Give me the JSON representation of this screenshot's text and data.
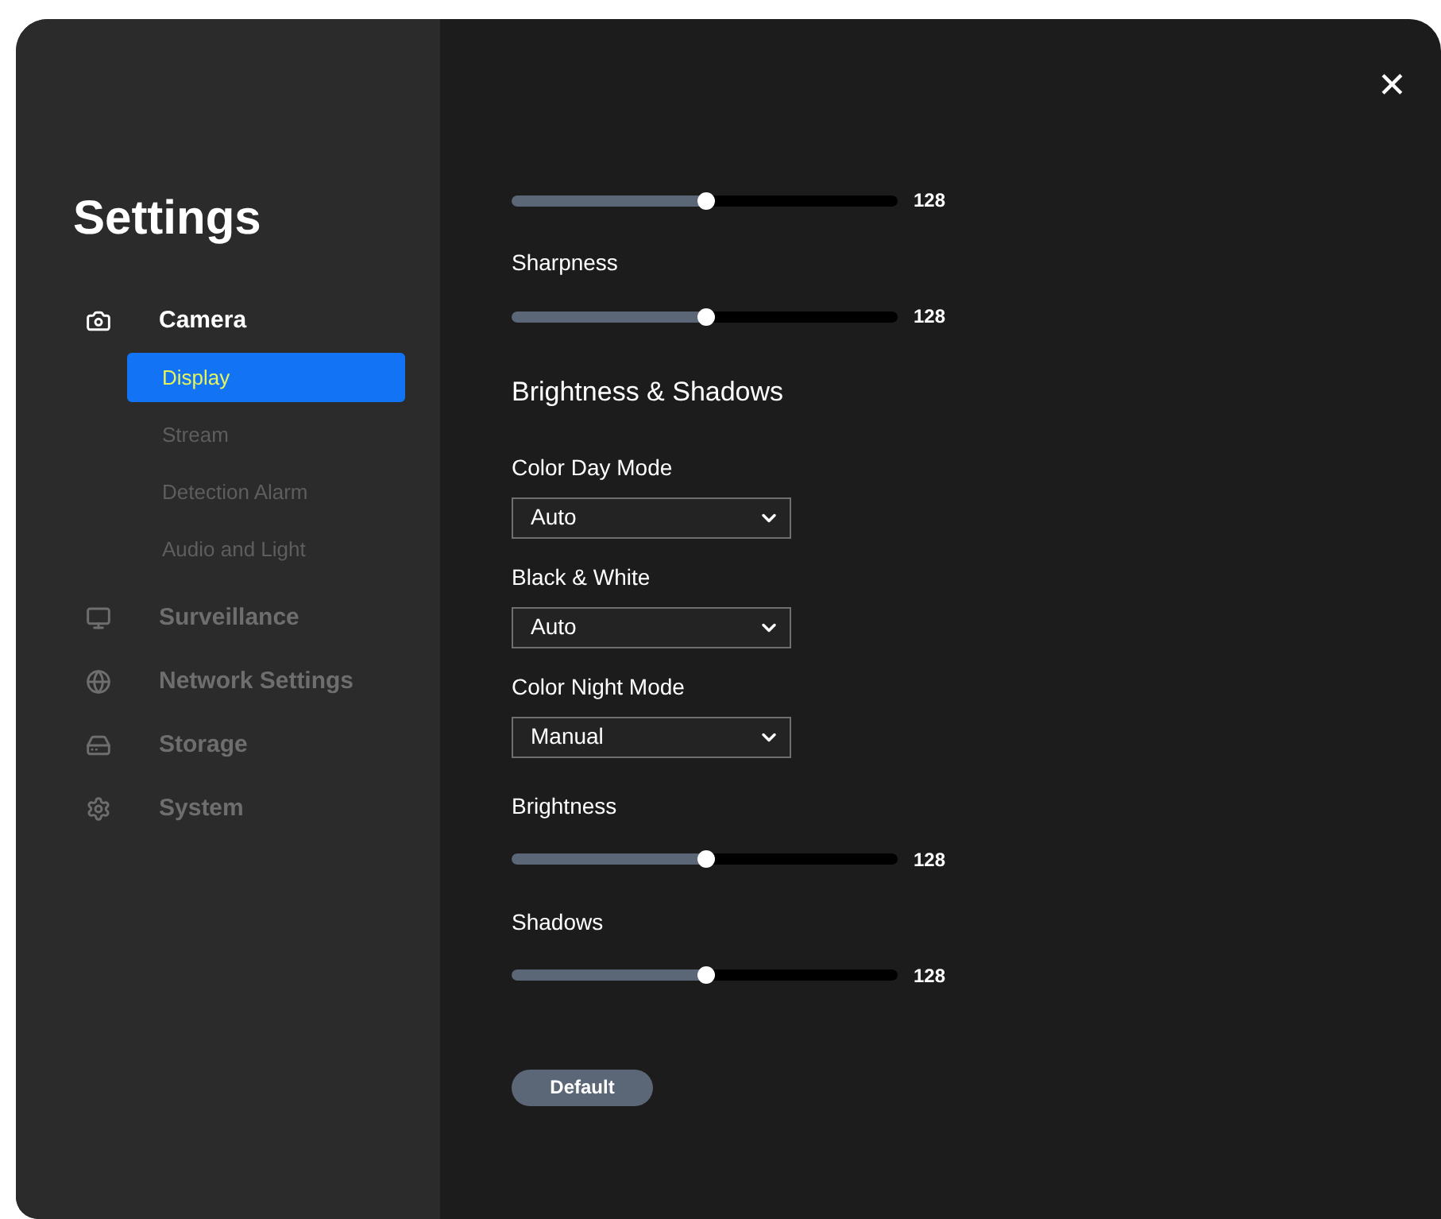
{
  "sidebar": {
    "title": "Settings",
    "items": [
      {
        "label": "Camera",
        "expanded": true,
        "children": [
          {
            "label": "Display",
            "selected": true
          },
          {
            "label": "Stream",
            "selected": false
          },
          {
            "label": "Detection Alarm",
            "selected": false
          },
          {
            "label": "Audio and Light",
            "selected": false
          }
        ]
      },
      {
        "label": "Surveillance",
        "expanded": false
      },
      {
        "label": "Network Settings",
        "expanded": false
      },
      {
        "label": "Storage",
        "expanded": false
      },
      {
        "label": "System",
        "expanded": false
      }
    ]
  },
  "close": "✕",
  "content": [
    {
      "kind": "slider",
      "level": 0.5,
      "reading": "128"
    },
    {
      "kind": "slider",
      "label": "Sharpness",
      "level": 0.5,
      "reading": "128"
    },
    {
      "kind": "heading",
      "label": "Brightness & Shadows"
    },
    {
      "kind": "select",
      "label": "Color Day Mode",
      "value": "Auto"
    },
    {
      "kind": "select",
      "label": "Black & White",
      "value": "Auto"
    },
    {
      "kind": "select",
      "label": "Color Night Mode",
      "value": "Manual"
    },
    {
      "kind": "slider",
      "label": "Brightness",
      "level": 0.5,
      "reading": "128"
    },
    {
      "kind": "slider",
      "label": "Shadows",
      "level": 0.5,
      "reading": "128"
    },
    {
      "kind": "button",
      "label": "Default"
    }
  ]
}
